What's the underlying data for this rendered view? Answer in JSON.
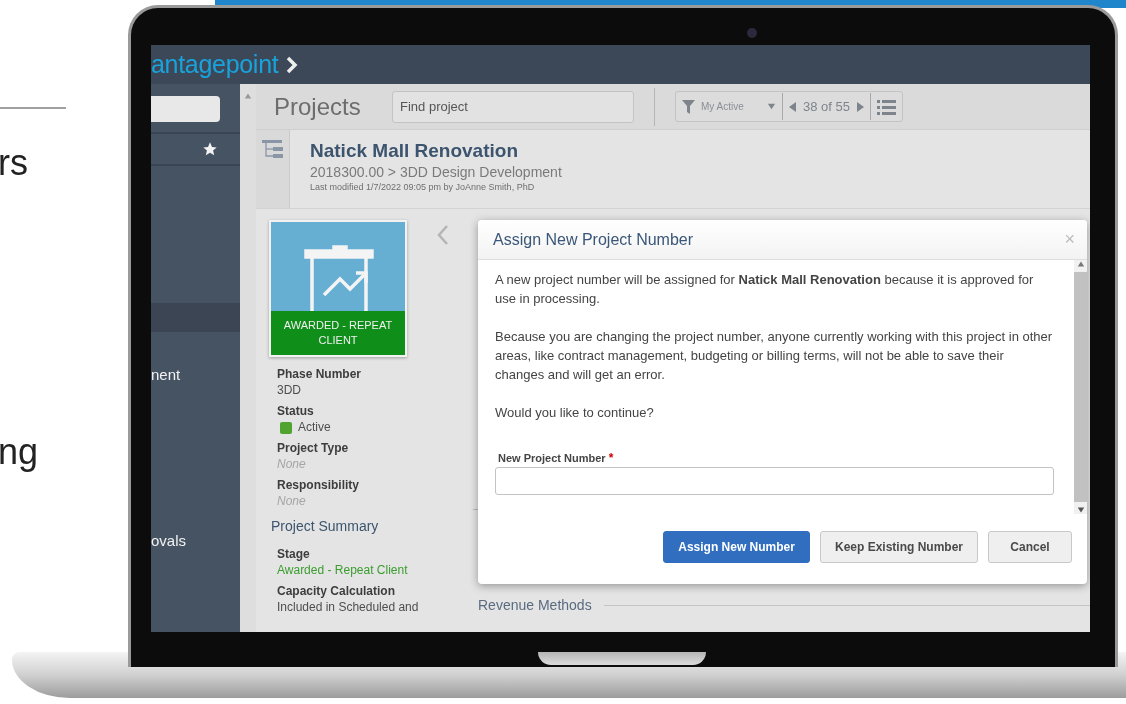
{
  "marketing_fragments": [
    "rs",
    "ng"
  ],
  "app": {
    "brand": "antagepoint",
    "sidebar": {
      "items": [
        {
          "label": "nent"
        },
        {
          "label": "ovals"
        }
      ]
    },
    "toolbar": {
      "title": "Projects",
      "search": {
        "placeholder": "Find project"
      },
      "filter": "My Active",
      "pager": "38 of 55"
    },
    "record": {
      "title": "Natick Mall Renovation",
      "path": "2018300.00 > 3DD Design Development",
      "modified": "Last modified 1/7/2022 09:05 pm by JoAnne Smith, PhD"
    },
    "card": {
      "stage": "AWARDED - REPEAT CLIENT"
    },
    "fields": [
      {
        "label": "Phase Number",
        "value": "3DD",
        "kind": "text"
      },
      {
        "label": "Status",
        "value": "Active",
        "kind": "status",
        "color": "#4fa32e"
      },
      {
        "label": "Project Type",
        "value": "None",
        "kind": "empty"
      },
      {
        "label": "Responsibility",
        "value": "None",
        "kind": "empty"
      }
    ],
    "summary": {
      "heading": "Project Summary",
      "fields": [
        {
          "label": "Stage",
          "value": "Awarded - Repeat Client",
          "kind": "highlight"
        },
        {
          "label": "Capacity Calculation",
          "value": "Included in Scheduled and",
          "kind": "text"
        }
      ]
    },
    "section": "Revenue Methods",
    "dialog": {
      "title": "Assign New Project Number",
      "close": "×",
      "paragraphs": [
        "A new project number will be assigned for **Natick Mall Renovation** because it is approved for use in processing.",
        "Because you are changing the project number, anyone currently working with this project in other areas, like contract management, budgeting or billing terms, will not be able to save their changes and will get an error.",
        "Would you like to continue?"
      ],
      "field": {
        "label": "New Project Number",
        "required": true,
        "required_mark": "*"
      },
      "buttons": [
        {
          "label": "Assign New Number",
          "kind": "primary"
        },
        {
          "label": "Keep Existing Number",
          "kind": "secondary"
        },
        {
          "label": "Cancel",
          "kind": "secondary"
        }
      ]
    }
  }
}
